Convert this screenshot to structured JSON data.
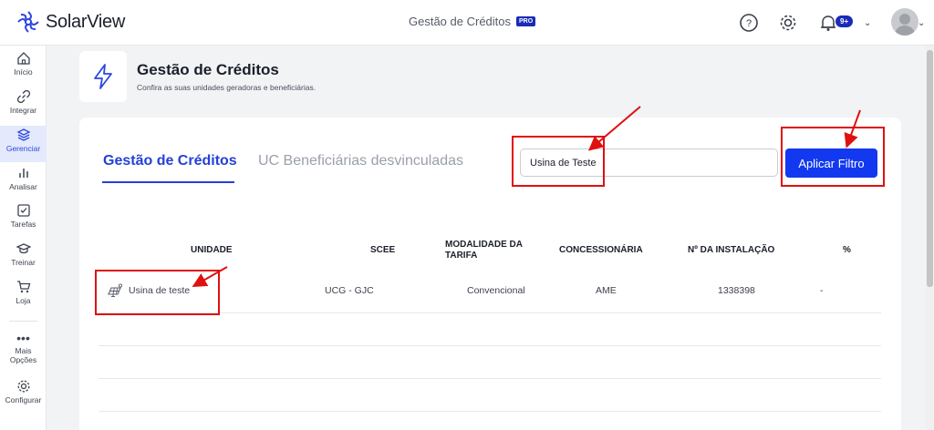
{
  "app": {
    "name": "SolarView"
  },
  "topbar": {
    "section_title": "Gestão de Créditos",
    "badge": "PRO",
    "notif_count": "9+"
  },
  "sidebar": {
    "items": [
      {
        "label": "Início",
        "icon": "home-icon"
      },
      {
        "label": "Integrar",
        "icon": "link-icon"
      },
      {
        "label": "Gerenciar",
        "icon": "layers-icon"
      },
      {
        "label": "Analisar",
        "icon": "bar-chart-icon"
      },
      {
        "label": "Tarefas",
        "icon": "checkbox-icon"
      },
      {
        "label": "Treinar",
        "icon": "graduation-cap-icon"
      },
      {
        "label": "Loja",
        "icon": "cart-icon"
      }
    ],
    "more_line1": "Mais",
    "more_line2": "Opções",
    "settings": "Configurar"
  },
  "header": {
    "title": "Gestão de Créditos",
    "subtitle": "Confira as suas unidades geradoras e beneficiárias."
  },
  "tabs": [
    {
      "label": "Gestão de Créditos"
    },
    {
      "label": "UC Beneficiárias desvinculadas"
    }
  ],
  "filter": {
    "search_value": "Usina de Teste",
    "apply_label": "Aplicar Filtro"
  },
  "table": {
    "columns": [
      "UNIDADE",
      "SCEE",
      "MODALIDADE DA",
      "TARIFA",
      "CONCESSIONÁRIA",
      "Nº DA INSTALAÇÃO",
      "%"
    ],
    "rows": [
      {
        "unidade": "Usina de teste",
        "scee": "UCG - GJC",
        "modalidade": "Convencional",
        "concessionaria": "AME",
        "instalacao": "1338398",
        "percent": "-"
      }
    ]
  },
  "colors": {
    "accent": "#1239f0",
    "tab_active": "#2540d8",
    "annotation": "#e01010"
  }
}
